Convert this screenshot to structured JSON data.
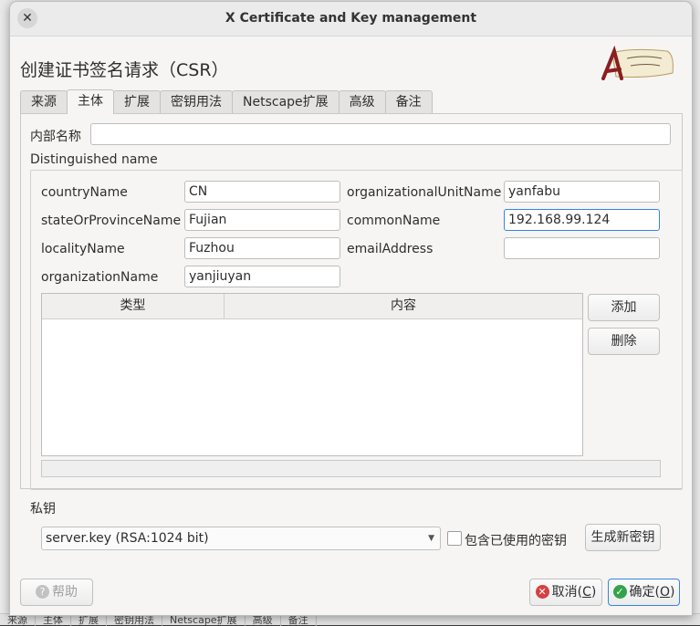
{
  "window": {
    "title": "X Certificate and Key management"
  },
  "heading": "创建证书签名请求（CSR）",
  "logo_alt": "",
  "tabs": [
    {
      "label": "来源",
      "active": false
    },
    {
      "label": "主体",
      "active": true
    },
    {
      "label": "扩展",
      "active": false
    },
    {
      "label": "密钥用法",
      "active": false
    },
    {
      "label": "Netscape扩展",
      "active": false
    },
    {
      "label": "高级",
      "active": false
    },
    {
      "label": "备注",
      "active": false
    }
  ],
  "subject": {
    "internal_name_label": "内部名称",
    "internal_name_value": "",
    "dn_label": "Distinguished name",
    "fields": {
      "countryName": {
        "label": "countryName",
        "value": "CN"
      },
      "stateOrProvinceName": {
        "label": "stateOrProvinceName",
        "value": "Fujian"
      },
      "localityName": {
        "label": "localityName",
        "value": "Fuzhou"
      },
      "organizationName": {
        "label": "organizationName",
        "value": "yanjiuyan"
      },
      "organizationalUnitName": {
        "label": "organizationalUnitName",
        "value": "yanfabu"
      },
      "commonName": {
        "label": "commonName",
        "value": "192.168.99.124"
      },
      "emailAddress": {
        "label": "emailAddress",
        "value": ""
      }
    },
    "table": {
      "col_type": "类型",
      "col_content": "内容",
      "rows": []
    },
    "add_button": "添加",
    "delete_button": "删除"
  },
  "private_key": {
    "label": "私钥",
    "selected": "server.key (RSA:1024 bit)",
    "include_used_label": "包含已使用的密钥",
    "include_used_checked": false,
    "generate_button": "生成新密钥"
  },
  "footer": {
    "help_button": "帮助",
    "cancel_button": "取消",
    "cancel_mnemonic": "C",
    "ok_button": "确定",
    "ok_mnemonic": "O"
  },
  "background_tabs": [
    "来源",
    "主体",
    "扩展",
    "密钥用法",
    "Netscape扩展",
    "高级",
    "备注"
  ],
  "colors": {
    "accent": "#3584e4",
    "cancel": "#d64141",
    "ok": "#33a34a"
  }
}
